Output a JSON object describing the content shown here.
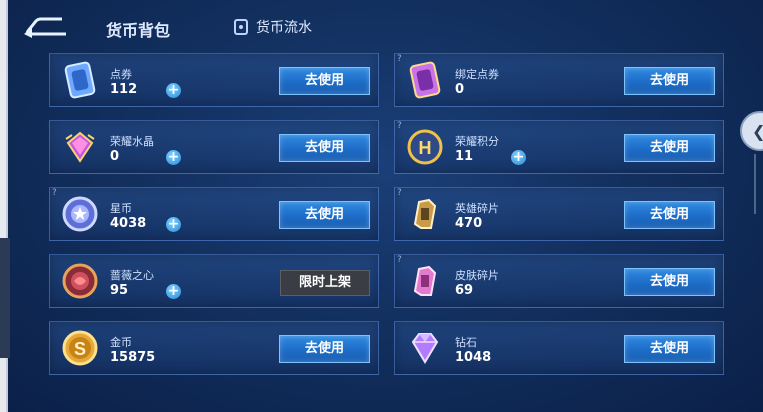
{
  "header": {
    "title": "货币背包",
    "flow_label": "货币流水"
  },
  "buttons": {
    "use_label": "去使用",
    "limited_label": "限时上架",
    "plus_label": "+"
  },
  "left_items": [
    {
      "name": "点券",
      "count": "112"
    },
    {
      "name": "荣耀水晶",
      "count": "0"
    },
    {
      "name": "星币",
      "count": "4038"
    },
    {
      "name": "蔷薇之心",
      "count": "95"
    },
    {
      "name": "金币",
      "count": "15875"
    }
  ],
  "right_items": [
    {
      "name": "绑定点券",
      "count": "0"
    },
    {
      "name": "荣耀积分",
      "count": "11"
    },
    {
      "name": "英雄碎片",
      "count": "470"
    },
    {
      "name": "皮肤碎片",
      "count": "69"
    },
    {
      "name": "钻石",
      "count": "1048"
    }
  ],
  "icon_text": {
    "honor_points": "H",
    "gold_coin": "S",
    "question_mark": "?"
  }
}
